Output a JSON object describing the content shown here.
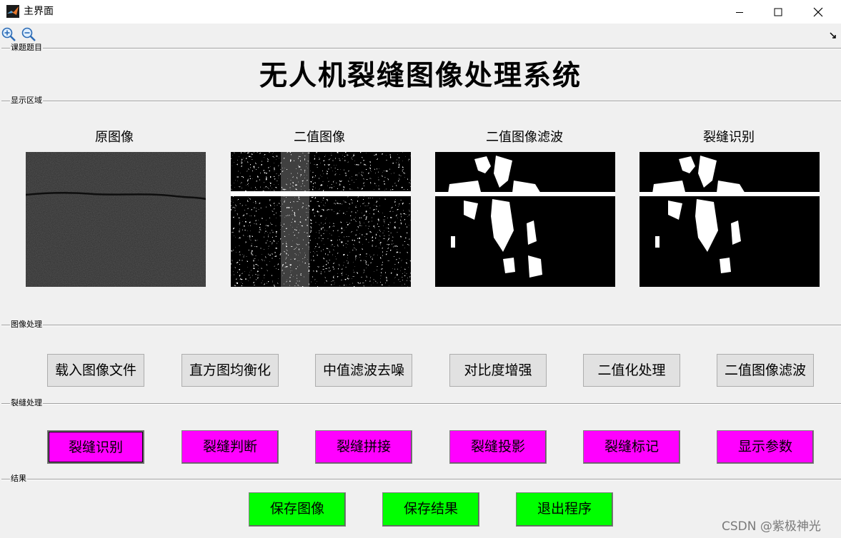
{
  "window": {
    "title": "主界面",
    "icons": [
      "matlab-logo-icon",
      "minimize-icon",
      "maximize-icon",
      "close-icon"
    ]
  },
  "toolbar": {
    "icons": [
      "zoom-in-icon",
      "zoom-out-icon",
      "dock-arrow-icon"
    ]
  },
  "panels": {
    "title": {
      "legend": "课题题目",
      "text": "无人机裂缝图像处理系统"
    },
    "display": {
      "legend": "显示区域",
      "images": [
        {
          "label": "原图像"
        },
        {
          "label": "二值图像"
        },
        {
          "label": "二值图像滤波"
        },
        {
          "label": "裂缝识别"
        }
      ]
    },
    "image_processing": {
      "legend": "图像处理",
      "buttons": [
        "载入图像文件",
        "直方图均衡化",
        "中值滤波去噪",
        "对比度增强",
        "二值化处理",
        "二值图像滤波"
      ]
    },
    "crack_processing": {
      "legend": "裂缝处理",
      "buttons": [
        "裂缝识别",
        "裂缝判断",
        "裂缝拼接",
        "裂缝投影",
        "裂缝标记",
        "显示参数"
      ]
    },
    "result": {
      "legend": "结果",
      "buttons": [
        "保存图像",
        "保存结果",
        "退出程序"
      ]
    }
  },
  "colors": {
    "crack_button": "#ff00ff",
    "result_button": "#00ff00",
    "default_button": "#e1e1e1",
    "background": "#f0f0f0"
  },
  "watermark": "CSDN @紫极神光"
}
